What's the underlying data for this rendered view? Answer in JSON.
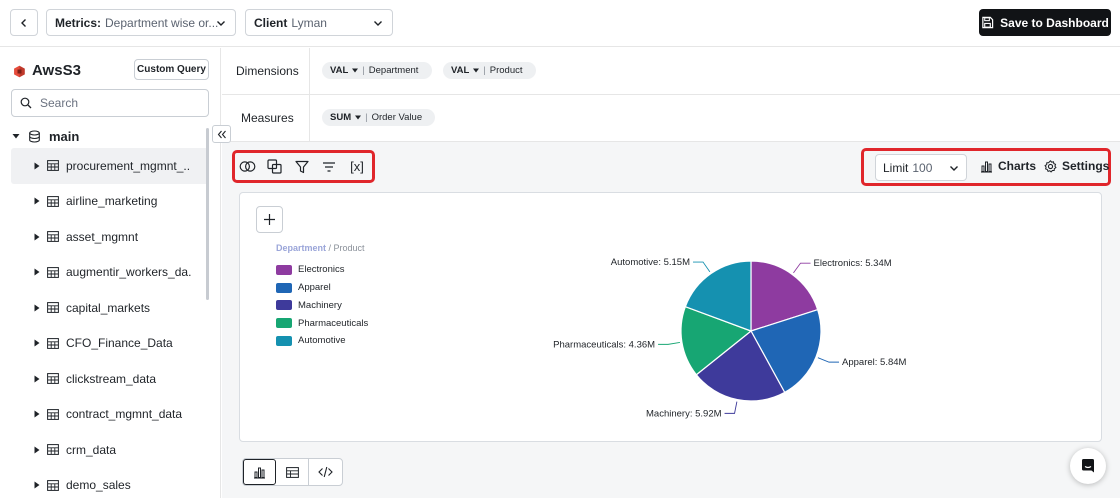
{
  "topbar": {
    "metrics_label": "Metrics:",
    "metrics_value": "Department wise or...",
    "client_label": "Client",
    "client_value": "Lyman",
    "save_label": "Save to Dashboard"
  },
  "sidebar": {
    "source_title": "AwsS3",
    "custom_query_label": "Custom Query",
    "search_placeholder": "Search",
    "database": "main",
    "tables": [
      "procurement_mgmnt_...",
      "airline_marketing",
      "asset_mgmnt",
      "augmentir_workers_da...",
      "capital_markets",
      "CFO_Finance_Data",
      "clickstream_data",
      "contract_mgmnt_data",
      "crm_data",
      "demo_sales"
    ]
  },
  "dimensions": {
    "label": "Dimensions",
    "items": [
      {
        "agg": "VAL",
        "field": "Department"
      },
      {
        "agg": "VAL",
        "field": "Product"
      }
    ]
  },
  "measures": {
    "label": "Measures",
    "items": [
      {
        "agg": "SUM",
        "field": "Order Value"
      }
    ]
  },
  "toolbar": {
    "limit_label": "Limit",
    "limit_value": "100",
    "charts_label": "Charts",
    "settings_label": "Settings",
    "var_label": "[x]"
  },
  "legend": {
    "title_primary": "Department",
    "title_sep": " / ",
    "title_secondary": "Product"
  },
  "chart_data": {
    "type": "pie",
    "categories": [
      "Electronics",
      "Apparel",
      "Machinery",
      "Pharmaceuticals",
      "Automotive"
    ],
    "values": [
      5.34,
      5.84,
      5.92,
      4.36,
      5.15
    ],
    "labels": [
      "Electronics: 5.34M",
      "Apparel: 5.84M",
      "Machinery: 5.92M",
      "Pharmaceuticals: 4.36M",
      "Automotive: 5.15M"
    ],
    "colors": [
      "#8e3ba0",
      "#1f66b5",
      "#3e3a9b",
      "#17a673",
      "#1591b0"
    ],
    "unit": "M",
    "legend_position": "top-left"
  }
}
